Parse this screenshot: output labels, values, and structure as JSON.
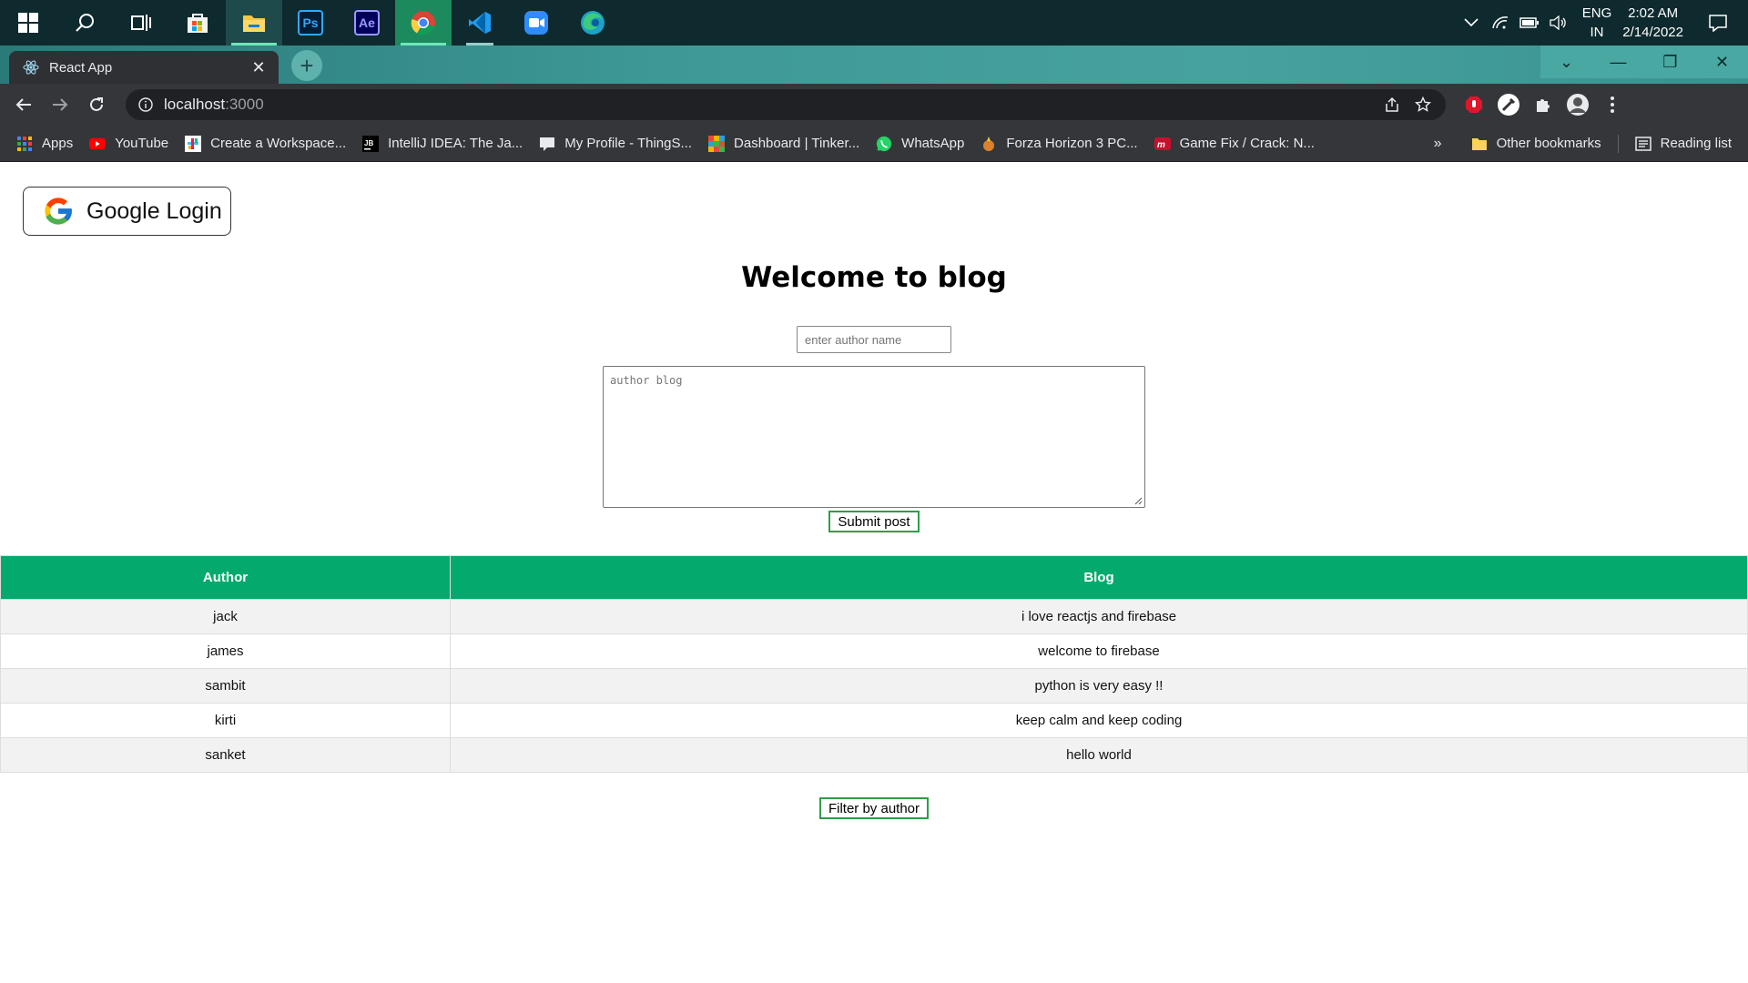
{
  "taskbar": {
    "apps": [
      {
        "name": "windows-start-icon"
      },
      {
        "name": "search-icon"
      },
      {
        "name": "task-view-icon"
      },
      {
        "name": "microsoft-store-icon"
      },
      {
        "name": "file-explorer-icon"
      },
      {
        "name": "photoshop-icon",
        "label": "Ps"
      },
      {
        "name": "after-effects-icon",
        "label": "Ae"
      },
      {
        "name": "chrome-icon"
      },
      {
        "name": "vscode-icon"
      },
      {
        "name": "zoom-icon"
      },
      {
        "name": "edge-icon"
      }
    ],
    "lang_line1": "ENG",
    "lang_line2": "IN",
    "time": "2:02 AM",
    "date": "2/14/2022"
  },
  "browser": {
    "tab_title": "React App",
    "url_host": "localhost",
    "url_port": ":3000",
    "bookmarks": [
      {
        "label": "Apps",
        "icon": "apps-grid-icon"
      },
      {
        "label": "YouTube",
        "icon": "youtube-icon"
      },
      {
        "label": "Create a Workspace...",
        "icon": "slack-icon"
      },
      {
        "label": "IntelliJ IDEA: The Ja...",
        "icon": "jetbrains-icon"
      },
      {
        "label": "My Profile - ThingS...",
        "icon": "thingspeak-icon"
      },
      {
        "label": "Dashboard | Tinker...",
        "icon": "tinkercad-icon"
      },
      {
        "label": "WhatsApp",
        "icon": "whatsapp-icon"
      },
      {
        "label": "Forza Horizon 3 PC...",
        "icon": "forza-icon"
      },
      {
        "label": "Game Fix / Crack: N...",
        "icon": "gamefix-icon"
      }
    ],
    "overflow": "»",
    "other_bookmarks": "Other bookmarks",
    "reading_list": "Reading list"
  },
  "page": {
    "google_login": "Google Login",
    "heading": "Welcome to blog",
    "author_placeholder": "enter author name",
    "blog_placeholder": "author blog",
    "submit_label": "Submit post",
    "filter_label": "Filter by author",
    "table": {
      "headers": [
        "Author",
        "Blog"
      ],
      "rows": [
        {
          "author": "jack",
          "blog": "i love reactjs and firebase"
        },
        {
          "author": "james",
          "blog": "welcome to firebase"
        },
        {
          "author": "sambit",
          "blog": "python is very easy !!"
        },
        {
          "author": "kirti",
          "blog": "keep calm and keep coding"
        },
        {
          "author": "sanket",
          "blog": "hello world"
        }
      ]
    }
  },
  "colors": {
    "header_green": "#04aa6d",
    "button_border": "#2e9e4a"
  }
}
